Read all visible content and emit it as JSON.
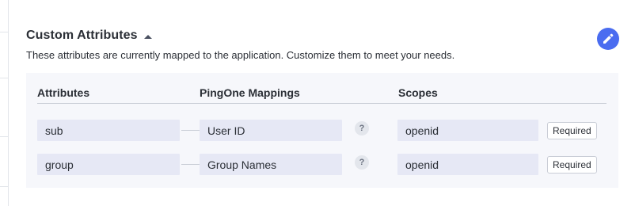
{
  "section": {
    "title": "Custom Attributes",
    "description": "These attributes are currently mapped to the application. Customize them to meet your needs.",
    "edit_icon": "pencil-icon",
    "collapse_icon": "caret-up-icon"
  },
  "table": {
    "headers": {
      "attributes": "Attributes",
      "mappings": "PingOne Mappings",
      "scopes": "Scopes"
    },
    "rows": [
      {
        "attribute": "sub",
        "mapping": "User ID",
        "help": "?",
        "scope": "openid",
        "badge": "Required"
      },
      {
        "attribute": "group",
        "mapping": "Group Names",
        "help": "?",
        "scope": "openid",
        "badge": "Required"
      }
    ]
  },
  "colors": {
    "accent": "#4a6cf0",
    "panel_bg": "#f6f7fb",
    "field_bg": "#e6e8f5",
    "text": "#2b2f36"
  }
}
